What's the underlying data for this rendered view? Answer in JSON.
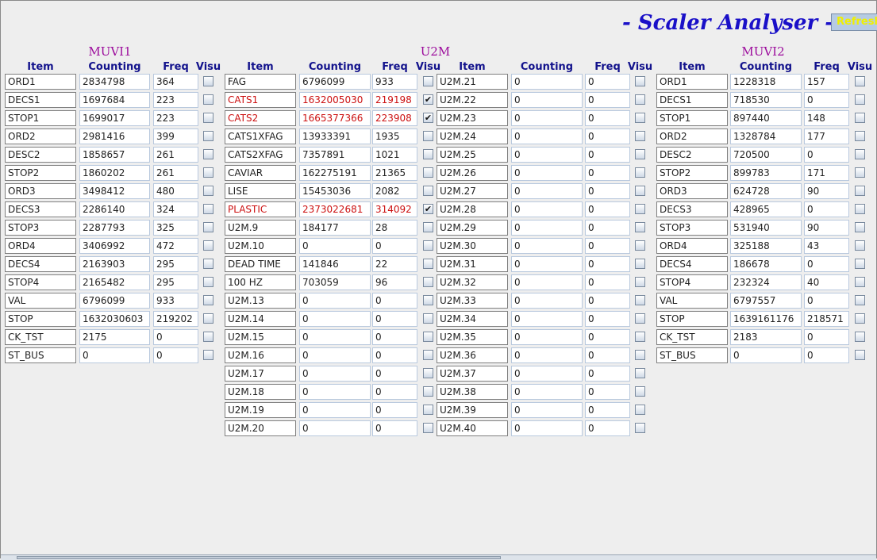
{
  "title": "- Scaler Analyser -",
  "refresh_label": "Refresh",
  "colors": {
    "title": "#1a10c8",
    "panel_title": "#9c0c9c",
    "header": "#12128c",
    "alarm": "#cc1010",
    "refresh_text": "#f0f000"
  },
  "panels": {
    "muvi1": {
      "name": "MUVI1",
      "headers": {
        "item": "Item",
        "counting": "Counting",
        "freq": "Freq",
        "visu": "Visu"
      },
      "rows": [
        {
          "item": "ORD1",
          "counting": "2834798",
          "freq": "364",
          "visu": false,
          "alarm": false
        },
        {
          "item": "DECS1",
          "counting": "1697684",
          "freq": "223",
          "visu": false,
          "alarm": false
        },
        {
          "item": "STOP1",
          "counting": "1699017",
          "freq": "223",
          "visu": false,
          "alarm": false
        },
        {
          "item": "ORD2",
          "counting": "2981416",
          "freq": "399",
          "visu": false,
          "alarm": false
        },
        {
          "item": "DESC2",
          "counting": "1858657",
          "freq": "261",
          "visu": false,
          "alarm": false
        },
        {
          "item": "STOP2",
          "counting": "1860202",
          "freq": "261",
          "visu": false,
          "alarm": false
        },
        {
          "item": "ORD3",
          "counting": "3498412",
          "freq": "480",
          "visu": false,
          "alarm": false
        },
        {
          "item": "DECS3",
          "counting": "2286140",
          "freq": "324",
          "visu": false,
          "alarm": false
        },
        {
          "item": "STOP3",
          "counting": "2287793",
          "freq": "325",
          "visu": false,
          "alarm": false
        },
        {
          "item": "ORD4",
          "counting": "3406992",
          "freq": "472",
          "visu": false,
          "alarm": false
        },
        {
          "item": "DECS4",
          "counting": "2163903",
          "freq": "295",
          "visu": false,
          "alarm": false
        },
        {
          "item": "STOP4",
          "counting": "2165482",
          "freq": "295",
          "visu": false,
          "alarm": false
        },
        {
          "item": "VAL",
          "counting": "6796099",
          "freq": "933",
          "visu": false,
          "alarm": false
        },
        {
          "item": "STOP",
          "counting": "1632030603",
          "freq": "219202",
          "visu": false,
          "alarm": false
        },
        {
          "item": "CK_TST",
          "counting": "2175",
          "freq": "0",
          "visu": false,
          "alarm": false
        },
        {
          "item": "ST_BUS",
          "counting": "0",
          "freq": "0",
          "visu": false,
          "alarm": false
        }
      ]
    },
    "u2m": {
      "name": "U2M",
      "headers": {
        "item": "Item",
        "counting": "Counting",
        "freq": "Freq",
        "visu": "Visu"
      },
      "headers2": {
        "item": "Item",
        "counting": "Counting",
        "freq": "Freq",
        "visu": "Visu"
      },
      "rows": [
        {
          "item": "FAG",
          "counting": "6796099",
          "freq": "933",
          "visu": false,
          "alarm": false
        },
        {
          "item": "CATS1",
          "counting": "1632005030",
          "freq": "219198",
          "visu": true,
          "alarm": true
        },
        {
          "item": "CATS2",
          "counting": "1665377366",
          "freq": "223908",
          "visu": true,
          "alarm": true
        },
        {
          "item": "CATS1XFAG",
          "counting": "13933391",
          "freq": "1935",
          "visu": false,
          "alarm": false
        },
        {
          "item": "CATS2XFAG",
          "counting": "7357891",
          "freq": "1021",
          "visu": false,
          "alarm": false
        },
        {
          "item": "CAVIAR",
          "counting": "162275191",
          "freq": "21365",
          "visu": false,
          "alarm": false
        },
        {
          "item": "LISE",
          "counting": "15453036",
          "freq": "2082",
          "visu": false,
          "alarm": false
        },
        {
          "item": "PLASTIC",
          "counting": "2373022681",
          "freq": "314092",
          "visu": true,
          "alarm": true
        },
        {
          "item": "U2M.9",
          "counting": "184177",
          "freq": "28",
          "visu": false,
          "alarm": false
        },
        {
          "item": "U2M.10",
          "counting": "0",
          "freq": "0",
          "visu": false,
          "alarm": false
        },
        {
          "item": "DEAD TIME",
          "counting": "141846",
          "freq": "22",
          "visu": false,
          "alarm": false
        },
        {
          "item": "100 HZ",
          "counting": "703059",
          "freq": "96",
          "visu": false,
          "alarm": false
        },
        {
          "item": "U2M.13",
          "counting": "0",
          "freq": "0",
          "visu": false,
          "alarm": false
        },
        {
          "item": "U2M.14",
          "counting": "0",
          "freq": "0",
          "visu": false,
          "alarm": false
        },
        {
          "item": "U2M.15",
          "counting": "0",
          "freq": "0",
          "visu": false,
          "alarm": false
        },
        {
          "item": "U2M.16",
          "counting": "0",
          "freq": "0",
          "visu": false,
          "alarm": false
        },
        {
          "item": "U2M.17",
          "counting": "0",
          "freq": "0",
          "visu": false,
          "alarm": false
        },
        {
          "item": "U2M.18",
          "counting": "0",
          "freq": "0",
          "visu": false,
          "alarm": false
        },
        {
          "item": "U2M.19",
          "counting": "0",
          "freq": "0",
          "visu": false,
          "alarm": false
        },
        {
          "item": "U2M.20",
          "counting": "0",
          "freq": "0",
          "visu": false,
          "alarm": false
        }
      ],
      "rows2": [
        {
          "item": "U2M.21",
          "counting": "0",
          "freq": "0",
          "visu": false,
          "alarm": false
        },
        {
          "item": "U2M.22",
          "counting": "0",
          "freq": "0",
          "visu": false,
          "alarm": false
        },
        {
          "item": "U2M.23",
          "counting": "0",
          "freq": "0",
          "visu": false,
          "alarm": false
        },
        {
          "item": "U2M.24",
          "counting": "0",
          "freq": "0",
          "visu": false,
          "alarm": false
        },
        {
          "item": "U2M.25",
          "counting": "0",
          "freq": "0",
          "visu": false,
          "alarm": false
        },
        {
          "item": "U2M.26",
          "counting": "0",
          "freq": "0",
          "visu": false,
          "alarm": false
        },
        {
          "item": "U2M.27",
          "counting": "0",
          "freq": "0",
          "visu": false,
          "alarm": false
        },
        {
          "item": "U2M.28",
          "counting": "0",
          "freq": "0",
          "visu": false,
          "alarm": false
        },
        {
          "item": "U2M.29",
          "counting": "0",
          "freq": "0",
          "visu": false,
          "alarm": false
        },
        {
          "item": "U2M.30",
          "counting": "0",
          "freq": "0",
          "visu": false,
          "alarm": false
        },
        {
          "item": "U2M.31",
          "counting": "0",
          "freq": "0",
          "visu": false,
          "alarm": false
        },
        {
          "item": "U2M.32",
          "counting": "0",
          "freq": "0",
          "visu": false,
          "alarm": false
        },
        {
          "item": "U2M.33",
          "counting": "0",
          "freq": "0",
          "visu": false,
          "alarm": false
        },
        {
          "item": "U2M.34",
          "counting": "0",
          "freq": "0",
          "visu": false,
          "alarm": false
        },
        {
          "item": "U2M.35",
          "counting": "0",
          "freq": "0",
          "visu": false,
          "alarm": false
        },
        {
          "item": "U2M.36",
          "counting": "0",
          "freq": "0",
          "visu": false,
          "alarm": false
        },
        {
          "item": "U2M.37",
          "counting": "0",
          "freq": "0",
          "visu": false,
          "alarm": false
        },
        {
          "item": "U2M.38",
          "counting": "0",
          "freq": "0",
          "visu": false,
          "alarm": false
        },
        {
          "item": "U2M.39",
          "counting": "0",
          "freq": "0",
          "visu": false,
          "alarm": false
        },
        {
          "item": "U2M.40",
          "counting": "0",
          "freq": "0",
          "visu": false,
          "alarm": false
        }
      ]
    },
    "muvi2": {
      "name": "MUVI2",
      "headers": {
        "item": "Item",
        "counting": "Counting",
        "freq": "Freq",
        "visu": "Visu"
      },
      "rows": [
        {
          "item": "ORD1",
          "counting": "1228318",
          "freq": "157",
          "visu": false,
          "alarm": false
        },
        {
          "item": "DECS1",
          "counting": "718530",
          "freq": "0",
          "visu": false,
          "alarm": false
        },
        {
          "item": "STOP1",
          "counting": "897440",
          "freq": "148",
          "visu": false,
          "alarm": false
        },
        {
          "item": "ORD2",
          "counting": "1328784",
          "freq": "177",
          "visu": false,
          "alarm": false
        },
        {
          "item": "DESC2",
          "counting": "720500",
          "freq": "0",
          "visu": false,
          "alarm": false
        },
        {
          "item": "STOP2",
          "counting": "899783",
          "freq": "171",
          "visu": false,
          "alarm": false
        },
        {
          "item": "ORD3",
          "counting": "624728",
          "freq": "90",
          "visu": false,
          "alarm": false
        },
        {
          "item": "DECS3",
          "counting": "428965",
          "freq": "0",
          "visu": false,
          "alarm": false
        },
        {
          "item": "STOP3",
          "counting": "531940",
          "freq": "90",
          "visu": false,
          "alarm": false
        },
        {
          "item": "ORD4",
          "counting": "325188",
          "freq": "43",
          "visu": false,
          "alarm": false
        },
        {
          "item": "DECS4",
          "counting": "186678",
          "freq": "0",
          "visu": false,
          "alarm": false
        },
        {
          "item": "STOP4",
          "counting": "232324",
          "freq": "40",
          "visu": false,
          "alarm": false
        },
        {
          "item": "VAL",
          "counting": "6797557",
          "freq": "0",
          "visu": false,
          "alarm": false
        },
        {
          "item": "STOP",
          "counting": "1639161176",
          "freq": "218571",
          "visu": false,
          "alarm": false
        },
        {
          "item": "CK_TST",
          "counting": "2183",
          "freq": "0",
          "visu": false,
          "alarm": false
        },
        {
          "item": "ST_BUS",
          "counting": "0",
          "freq": "0",
          "visu": false,
          "alarm": false
        }
      ]
    }
  }
}
